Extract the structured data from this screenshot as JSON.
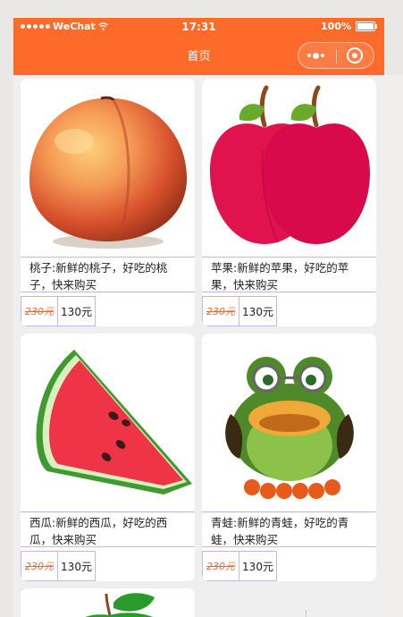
{
  "status_bar": {
    "carrier": "WeChat",
    "time": "17:31",
    "battery": "100%"
  },
  "nav": {
    "title": "首页"
  },
  "products": [
    {
      "name": "桃子",
      "desc": "桃子:新鲜的桃子，好吃的桃子，快来购买",
      "old_price": "230元",
      "price": "130元"
    },
    {
      "name": "苹果",
      "desc": "苹果:新鲜的苹果，好吃的苹果，快来购买",
      "old_price": "230元",
      "price": "130元"
    },
    {
      "name": "西瓜",
      "desc": "西瓜:新鲜的西瓜，好吃的西瓜，快来购买",
      "old_price": "230元",
      "price": "130元"
    },
    {
      "name": "青蛙",
      "desc": "青蛙:新鲜的青蛙，好吃的青蛙，快来购买",
      "old_price": "230元",
      "price": "130元"
    }
  ],
  "colors": {
    "header": "#fd6a2a",
    "border": "#c9b6e8",
    "strike_price": "#e07040"
  }
}
